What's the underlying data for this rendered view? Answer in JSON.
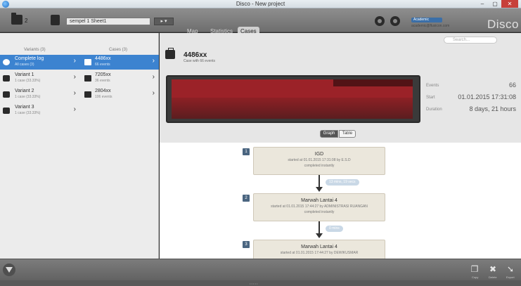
{
  "window": {
    "title": "Disco - New project",
    "minimize": "–",
    "maximize": "▢",
    "close": "✕"
  },
  "toolbar": {
    "project_count": "2",
    "dataset_name": "sempel 1 Sheet1",
    "dataset_button": "▸ ▾",
    "tabs": [
      "Map",
      "Statistics",
      "Cases"
    ],
    "active_tab": "Cases",
    "account_badge": "Academic",
    "account_email": "academic@fluxicon.com",
    "logo": "Disco"
  },
  "variants": {
    "header": "Variants (3)",
    "items": [
      {
        "label": "Complete log",
        "sub": "All cases (3)",
        "selected": true
      },
      {
        "label": "Variant 1",
        "sub": "1 case (33.33%)",
        "selected": false
      },
      {
        "label": "Variant 2",
        "sub": "1 case (33.33%)",
        "selected": false
      },
      {
        "label": "Variant 3",
        "sub": "1 case (33.33%)",
        "selected": false
      }
    ]
  },
  "cases": {
    "header": "Cases (3)",
    "items": [
      {
        "label": "4486xx",
        "sub": "66 events",
        "selected": true
      },
      {
        "label": "7205xx",
        "sub": "36 events",
        "selected": false
      },
      {
        "label": "2804xx",
        "sub": "106 events",
        "selected": false
      }
    ]
  },
  "detail": {
    "search_placeholder": "Search...",
    "case_id": "4486xx",
    "case_subtitle": "Case with 66 events",
    "stats": [
      {
        "label": "Events",
        "value": "66"
      },
      {
        "label": "Start",
        "value": "01.01.2015 17:31:08"
      },
      {
        "label": "Duration",
        "value": "8 days, 21 hours"
      }
    ],
    "view_toggle": [
      "Graph",
      "Table"
    ],
    "active_view": "Graph"
  },
  "activities": [
    {
      "num": "1",
      "name": "IGD",
      "line1": "started at 01.01.2015 17:31:08 by E.S.D",
      "line2": "completed instantly"
    },
    {
      "num": "2",
      "name": "Marwah Lantai 4",
      "line1": "started at 01.01.2015 17:44:27 by ADMINISTRASI RUANGAN",
      "line2": "completed instantly"
    },
    {
      "num": "3",
      "name": "Marwah Lantai 4",
      "line1": "started at 01.01.2015 17:44:27 by DEWIKUSMAR",
      "line2": ""
    }
  ],
  "durations": [
    "13 mins, 19 secs",
    "0 mins"
  ],
  "bottom": {
    "copy_label": "Copy",
    "delete_label": "Delete",
    "export_label": "Export"
  },
  "colors": {
    "selection": "#3c83d0",
    "timeline": "#9b2228",
    "close_button": "#c7403a"
  }
}
